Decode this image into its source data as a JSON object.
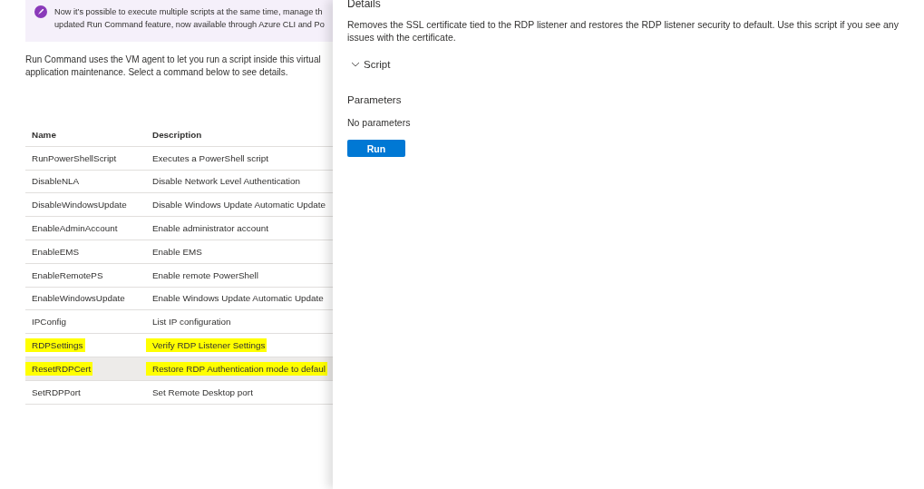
{
  "banner": {
    "lines": [
      "Now it’s possible to execute multiple scripts at the same time, manage th",
      "updated Run Command feature, now available through Azure CLI and Po"
    ]
  },
  "intro": {
    "lines": [
      "Run Command uses the VM agent to let you run a script inside this virtual",
      "application maintenance. Select a command below to see details."
    ]
  },
  "table": {
    "columns": [
      "Name",
      "Description"
    ],
    "rows": [
      {
        "name": "RunPowerShellScript",
        "description": "Executes a PowerShell script",
        "selected": false,
        "highlighted": false
      },
      {
        "name": "DisableNLA",
        "description": "Disable Network Level Authentication",
        "selected": false,
        "highlighted": false
      },
      {
        "name": "DisableWindowsUpdate",
        "description": "Disable Windows Update Automatic Update",
        "selected": false,
        "highlighted": false
      },
      {
        "name": "EnableAdminAccount",
        "description": "Enable administrator account",
        "selected": false,
        "highlighted": false
      },
      {
        "name": "EnableEMS",
        "description": "Enable EMS",
        "selected": false,
        "highlighted": false
      },
      {
        "name": "EnableRemotePS",
        "description": "Enable remote PowerShell",
        "selected": false,
        "highlighted": false
      },
      {
        "name": "EnableWindowsUpdate",
        "description": "Enable Windows Update Automatic Update",
        "selected": false,
        "highlighted": false
      },
      {
        "name": "IPConfig",
        "description": "List IP configuration",
        "selected": false,
        "highlighted": false
      },
      {
        "name": "RDPSettings",
        "description": "Verify RDP Listener Settings",
        "selected": false,
        "highlighted": true
      },
      {
        "name": "ResetRDPCert",
        "description": "Restore RDP Authentication mode to defaul",
        "selected": true,
        "highlighted": true
      },
      {
        "name": "SetRDPPort",
        "description": "Set Remote Desktop port",
        "selected": false,
        "highlighted": false
      }
    ]
  },
  "details": {
    "title": "Details",
    "description": "Removes the SSL certificate tied to the RDP listener and restores the RDP listener security to default. Use this script if you see any issues with the certificate.",
    "script": {
      "label": "Script",
      "expanded": false
    },
    "parameters_title": "Parameters",
    "parameters_text": "No parameters",
    "run_button": "Run"
  }
}
